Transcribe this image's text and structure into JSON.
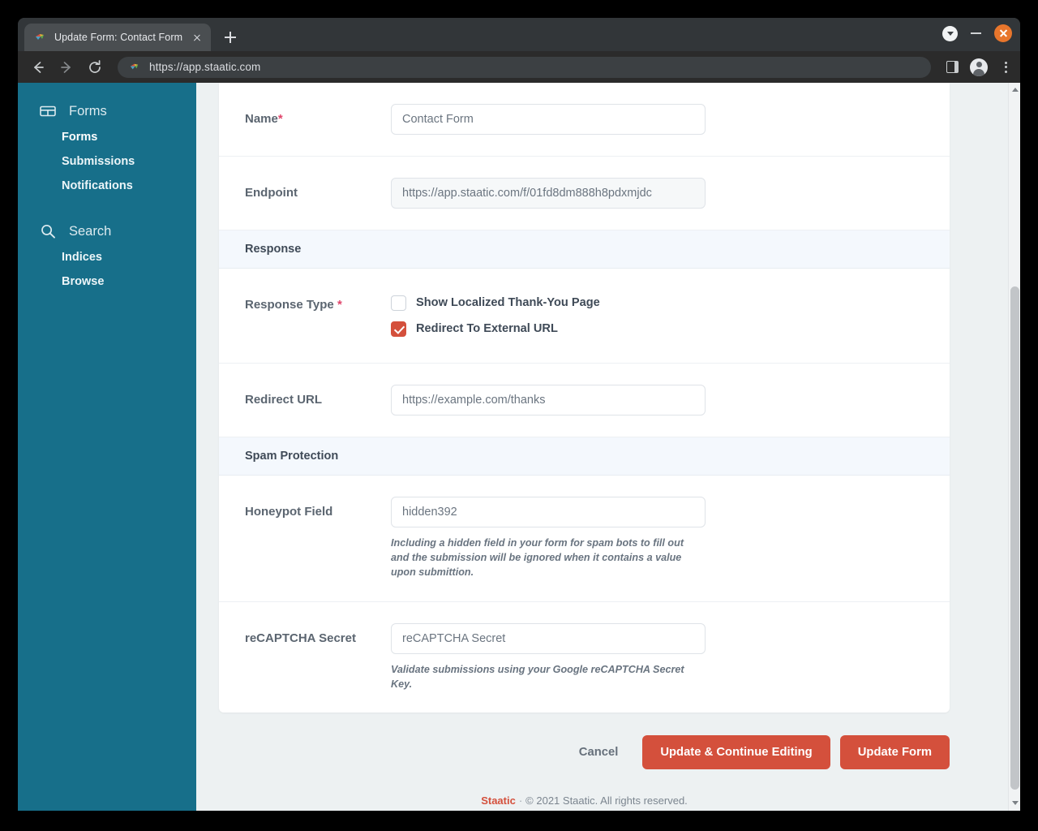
{
  "browser": {
    "tab": {
      "title": "Update Form: Contact Form |",
      "favicon": "staatic-bird-icon",
      "close_icon": "close-icon"
    },
    "new_tab_icon": "plus-icon",
    "window_controls": {
      "dropdown_icon": "chevron-down-icon",
      "minimize_icon": "minimize-icon",
      "close_icon": "close-icon"
    },
    "nav": {
      "back_icon": "arrow-left-icon",
      "forward_icon": "arrow-right-icon",
      "reload_icon": "reload-icon"
    },
    "omnibox": {
      "url": "https://app.staatic.com",
      "site_icon": "staatic-bird-icon"
    },
    "toolbar_right": {
      "side_panel_icon": "side-panel-icon",
      "profile_icon": "account-avatar-icon",
      "menu_icon": "three-dot-menu-icon"
    }
  },
  "sidebar": {
    "groups": [
      {
        "label": "Forms",
        "icon": "forms-table-icon",
        "items": [
          {
            "label": "Forms",
            "active": true
          },
          {
            "label": "Submissions",
            "active": false
          },
          {
            "label": "Notifications",
            "active": false
          }
        ]
      },
      {
        "label": "Search",
        "icon": "search-icon",
        "items": [
          {
            "label": "Indices",
            "active": false
          },
          {
            "label": "Browse",
            "active": false
          }
        ]
      }
    ]
  },
  "form": {
    "fields": {
      "name": {
        "label": "Name",
        "required_marker": "*",
        "value": "Contact Form"
      },
      "endpoint": {
        "label": "Endpoint",
        "value": "https://app.staatic.com/f/01fd8dm888h8pdxmjdc"
      },
      "redirect_url": {
        "label": "Redirect URL",
        "value": "https://example.com/thanks"
      },
      "honeypot": {
        "label": "Honeypot Field",
        "value": "hidden392",
        "help": "Including a hidden field in your form for spam bots to fill out and the submission will be ignored when it contains a value upon submittion."
      },
      "recaptcha_secret": {
        "label": "reCAPTCHA Secret",
        "placeholder": "reCAPTCHA Secret",
        "help": "Validate submissions using your Google reCAPTCHA Secret Key."
      }
    },
    "sections": {
      "response": "Response",
      "spam_protection": "Spam Protection"
    },
    "response_type": {
      "label": "Response Type",
      "required_marker": "*",
      "options": [
        {
          "label": "Show Localized Thank-You Page",
          "checked": false
        },
        {
          "label": "Redirect To External URL",
          "checked": true
        }
      ]
    }
  },
  "actions": {
    "cancel": "Cancel",
    "update_continue": "Update & Continue Editing",
    "update": "Update Form"
  },
  "footer": {
    "brand": "Staatic",
    "separator": "·",
    "copyright": "© 2021 Staatic. All rights reserved."
  },
  "colors": {
    "sidebar": "#176f8a",
    "accent": "#d4503c",
    "page_bg": "#edf1f2",
    "section_bg": "#f4f8fd",
    "required": "#e0456b"
  }
}
